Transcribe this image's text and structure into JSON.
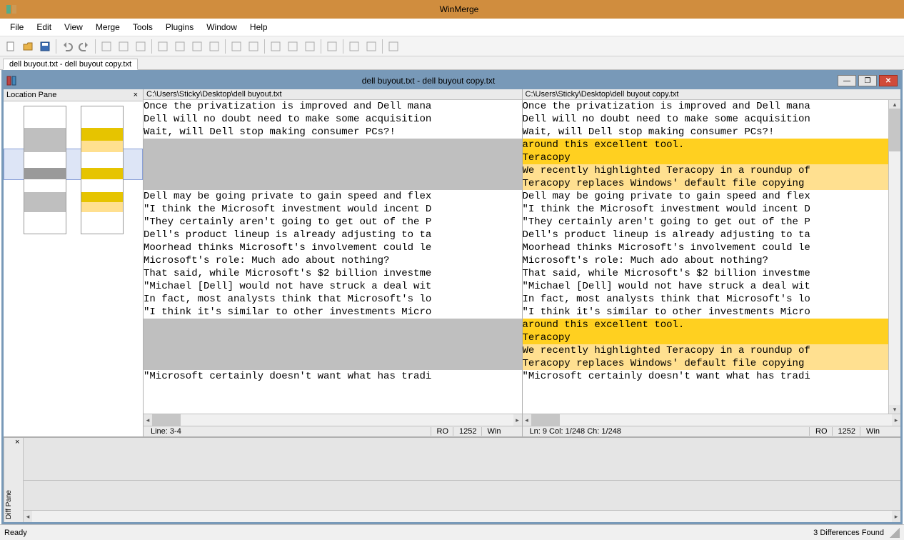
{
  "app": {
    "title": "WinMerge"
  },
  "menu": [
    "File",
    "Edit",
    "View",
    "Merge",
    "Tools",
    "Plugins",
    "Window",
    "Help"
  ],
  "tab": {
    "label": "dell buyout.txt - dell buyout copy.txt"
  },
  "ws": {
    "title": "dell buyout.txt - dell buyout copy.txt"
  },
  "location_pane": {
    "title": "Location Pane"
  },
  "left": {
    "path": "C:\\Users\\Sticky\\Desktop\\dell buyout.txt",
    "lines": [
      {
        "t": "Once the privatization is improved and Dell mana",
        "k": "n"
      },
      {
        "t": "Dell will no doubt need to make some acquisition",
        "k": "n"
      },
      {
        "t": "Wait, will Dell stop making consumer PCs?!",
        "k": "n"
      },
      {
        "t": "",
        "k": "b"
      },
      {
        "t": "",
        "k": "b"
      },
      {
        "t": "",
        "k": "b"
      },
      {
        "t": "",
        "k": "b"
      },
      {
        "t": "Dell may be going private to gain speed and flex",
        "k": "n"
      },
      {
        "t": "\"I think the Microsoft investment would incent D",
        "k": "n"
      },
      {
        "t": "\"They certainly aren't going to get out of the P",
        "k": "n"
      },
      {
        "t": "Dell's product lineup is already adjusting to ta",
        "k": "n"
      },
      {
        "t": "Moorhead thinks Microsoft's involvement could le",
        "k": "n"
      },
      {
        "t": "Microsoft's role: Much ado about nothing?",
        "k": "n"
      },
      {
        "t": "That said, while Microsoft's $2 billion investme",
        "k": "n"
      },
      {
        "t": "\"Michael [Dell] would not have struck a deal wit",
        "k": "n"
      },
      {
        "t": "In fact, most analysts think that Microsoft's lo",
        "k": "n"
      },
      {
        "t": "\"I think it's similar to other investments Micro",
        "k": "n"
      },
      {
        "t": "",
        "k": "b"
      },
      {
        "t": "",
        "k": "b"
      },
      {
        "t": "",
        "k": "b"
      },
      {
        "t": "",
        "k": "b"
      },
      {
        "t": "\"Microsoft certainly doesn't want what has tradi",
        "k": "n"
      }
    ],
    "status": {
      "pos": "Line: 3-4",
      "ro": "RO",
      "cp": "1252",
      "eol": "Win"
    }
  },
  "right": {
    "path": "C:\\Users\\Sticky\\Desktop\\dell buyout copy.txt",
    "lines": [
      {
        "t": "Once the privatization is improved and Dell mana",
        "k": "n"
      },
      {
        "t": "Dell will no doubt need to make some acquisition",
        "k": "n"
      },
      {
        "t": "Wait, will Dell stop making consumer PCs?!",
        "k": "n"
      },
      {
        "t": "around this excellent tool.",
        "k": "ds"
      },
      {
        "t": "Teracopy",
        "k": "ds"
      },
      {
        "t": "We recently highlighted Teracopy in a roundup of",
        "k": "d"
      },
      {
        "t": "Teracopy replaces Windows' default file copying ",
        "k": "d"
      },
      {
        "t": "Dell may be going private to gain speed and flex",
        "k": "n"
      },
      {
        "t": "\"I think the Microsoft investment would incent D",
        "k": "n"
      },
      {
        "t": "\"They certainly aren't going to get out of the P",
        "k": "n"
      },
      {
        "t": "Dell's product lineup is already adjusting to ta",
        "k": "n"
      },
      {
        "t": "Moorhead thinks Microsoft's involvement could le",
        "k": "n"
      },
      {
        "t": "Microsoft's role: Much ado about nothing?",
        "k": "n"
      },
      {
        "t": "That said, while Microsoft's $2 billion investme",
        "k": "n"
      },
      {
        "t": "\"Michael [Dell] would not have struck a deal wit",
        "k": "n"
      },
      {
        "t": "In fact, most analysts think that Microsoft's lo",
        "k": "n"
      },
      {
        "t": "\"I think it's similar to other investments Micro",
        "k": "n"
      },
      {
        "t": "around this excellent tool.",
        "k": "ds"
      },
      {
        "t": "Teracopy",
        "k": "ds"
      },
      {
        "t": "We recently highlighted Teracopy in a roundup of",
        "k": "d"
      },
      {
        "t": "Teracopy replaces Windows' default file copying ",
        "k": "d"
      },
      {
        "t": "\"Microsoft certainly doesn't want what has tradi",
        "k": "n"
      }
    ],
    "status": {
      "pos": "Ln: 9  Col: 1/248  Ch: 1/248",
      "ro": "RO",
      "cp": "1252",
      "eol": "Win"
    }
  },
  "diff_pane": {
    "label": "Diff Pane"
  },
  "statusbar": {
    "left": "Ready",
    "right": "3 Differences Found"
  },
  "toolbar_icons": [
    "new",
    "open",
    "save",
    "|",
    "undo",
    "redo",
    "|",
    "diff1",
    "diff2",
    "diff3",
    "|",
    "m1",
    "m2",
    "m3",
    "m4",
    "|",
    "n1",
    "n2",
    "|",
    "n3",
    "n4",
    "n5",
    "|",
    "sw",
    "|",
    "p1",
    "p2",
    "|",
    "ref"
  ]
}
